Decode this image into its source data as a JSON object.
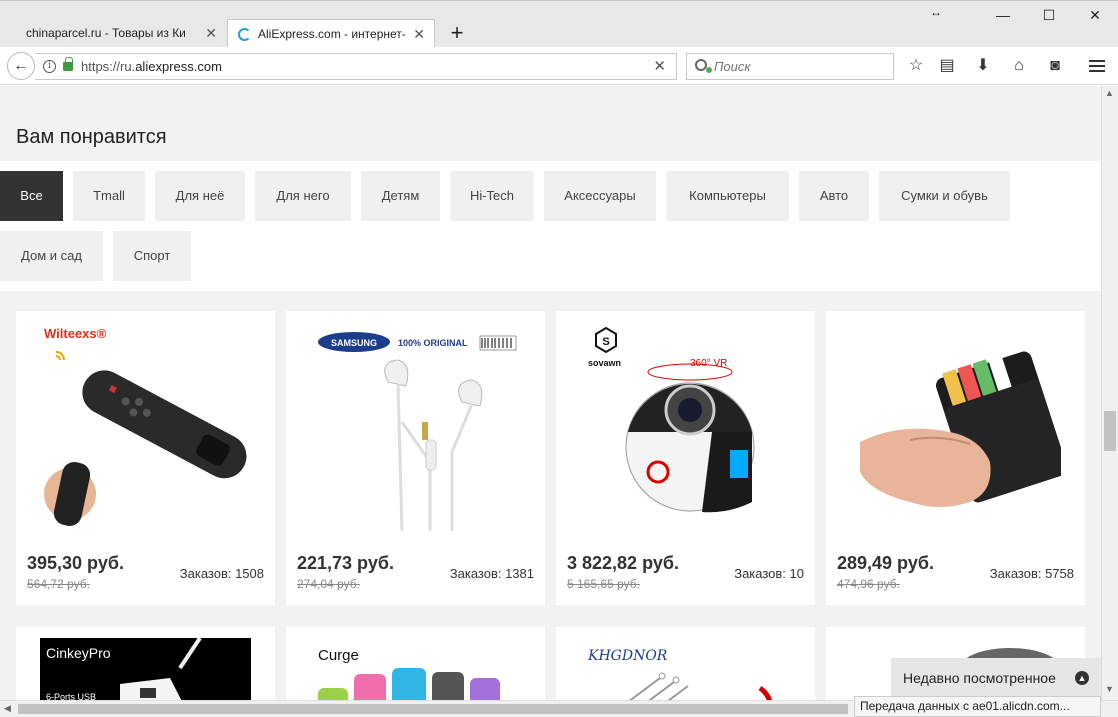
{
  "browser": {
    "tabs": [
      {
        "label": "chinaparcel.ru - Товары из Кита"
      },
      {
        "label": "AliExpress.com - интернет-"
      }
    ],
    "url_prefix": "https://ru.",
    "url_host": "aliexpress.com",
    "search_placeholder": "Поиск"
  },
  "section": {
    "title": "Вам понравится"
  },
  "categories": [
    "Все",
    "Tmall",
    "Для неё",
    "Для него",
    "Детям",
    "Hi-Tech",
    "Аксессуары",
    "Компьютеры",
    "Авто",
    "Сумки и обувь",
    "Дом и сад",
    "Спорт"
  ],
  "products": [
    {
      "brand": "Wilteexs®",
      "price": "395,30 руб.",
      "old_price": "564,72 руб.",
      "orders": "Заказов: 1508"
    },
    {
      "brand": "SAMSUNG",
      "brand_sub": "100% ORIGINAL",
      "price": "221,73 руб.",
      "old_price": "274,04 руб.",
      "orders": "Заказов: 1381"
    },
    {
      "brand": "sovawn",
      "badge": "360° VR",
      "price": "3 822,82 руб.",
      "old_price": "5 165,65 руб.",
      "orders": "Заказов: 10"
    },
    {
      "price": "289,49 руб.",
      "old_price": "474,96 руб.",
      "orders": "Заказов: 5758"
    }
  ],
  "products_row2": [
    {
      "brand": "CinkeyPro",
      "sub": "6-Ports USB"
    },
    {
      "brand": "Curge"
    },
    {
      "brand": "KHGDNOR"
    },
    {}
  ],
  "recent_label": "Недавно посмотренное",
  "status_text": "Передача данных с ae01.alicdn.com..."
}
